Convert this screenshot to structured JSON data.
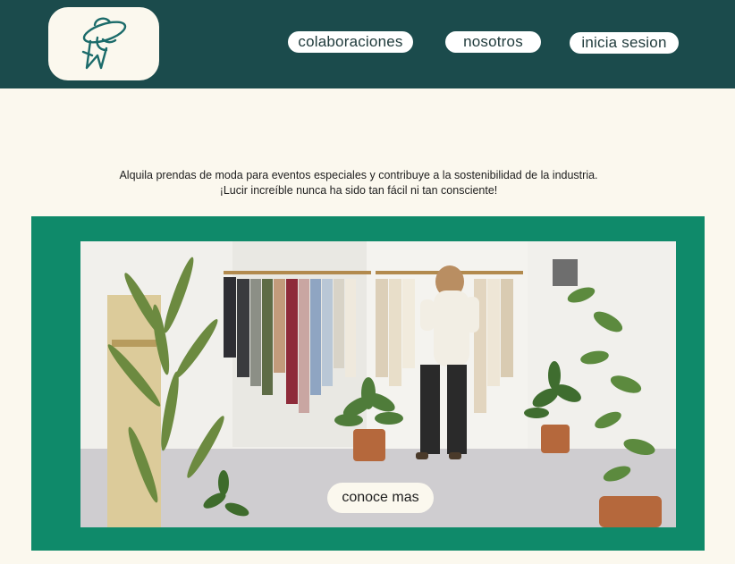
{
  "brand": {
    "logo_icon": "woman-with-hat-icon",
    "accent": "#1B4B4C",
    "cream": "#FBF8EE",
    "frame_green": "#0F8A6A"
  },
  "nav": {
    "collaborations": "colaboraciones",
    "about": "nosotros",
    "login": "inicia sesion"
  },
  "hero": {
    "tagline_line1": "Alquila prendas de moda para eventos especiales y contribuye a la sostenibilidad de la industria.",
    "tagline_line2": "¡Lucir increíble nunca ha sido tan fácil ni tan consciente!",
    "image_icon": "clothing-store-photo",
    "cta_label": "conoce mas"
  }
}
